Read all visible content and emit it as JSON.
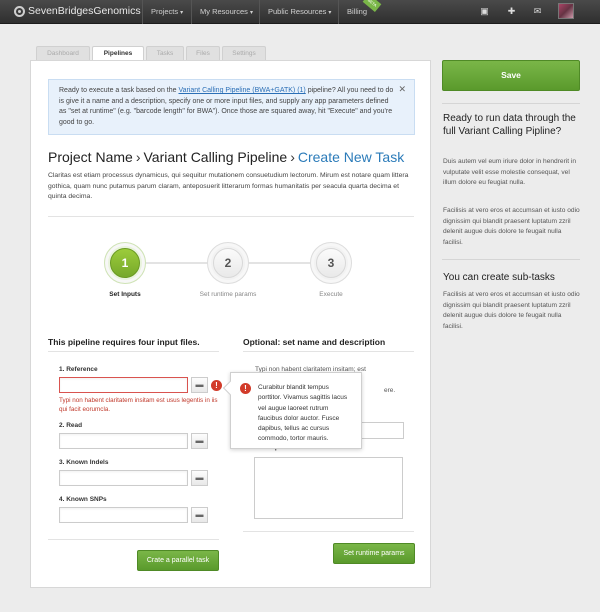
{
  "nav": {
    "logo": "SevenBridgesGenomics",
    "items": [
      {
        "label": "Projects",
        "caret": "▾"
      },
      {
        "label": "My Resources",
        "caret": "▾"
      },
      {
        "label": "Public Resources",
        "caret": "▾"
      },
      {
        "label": "Billing",
        "caret": ""
      }
    ],
    "beta_label": "BETA",
    "icons": [
      "presentation-icon",
      "add-user-icon",
      "mail-icon"
    ]
  },
  "tabs": [
    {
      "label": "Dashboard",
      "active": false
    },
    {
      "label": "Pipelines",
      "active": true
    },
    {
      "label": "Tasks",
      "active": false
    },
    {
      "label": "Files",
      "active": false
    },
    {
      "label": "Settings",
      "active": false
    }
  ],
  "alert": {
    "text_before": "Ready to execute a task based on the ",
    "link": "Variant Calling Pipeline (BWA+GATK) (1)",
    "text_after": " pipeline? All you need to do is give it a name and a description, specify one or more input files, and supply any app parameters defined as \"set at runtime\" (e.g. \"barcode length\" for BWA\"). Once those are squared away, hit \"Execute\" and you're good to go.",
    "close": "✕"
  },
  "breadcrumb": {
    "project": "Project Name",
    "separator": "›",
    "pipeline": "Variant Calling Pipeline",
    "current": "Create New Task"
  },
  "description": "Claritas est etiam processus dynamicus, qui sequitur mutationem consuetudium lectorum. Mirum est notare quam littera gothica, quam nunc putamus parum claram, anteposuerit litterarum formas humanitatis per seacula quarta decima et quinta decima.",
  "steps": [
    {
      "number": "1",
      "label": "Set Inputs",
      "active": true
    },
    {
      "number": "2",
      "label": "Set runtime params",
      "active": false
    },
    {
      "number": "3",
      "label": "Execute",
      "active": false
    }
  ],
  "inputs_section": {
    "title": "This pipeline requires four input files.",
    "fields": [
      {
        "label": "1. Reference",
        "error": true
      },
      {
        "label": "2. Read",
        "error": false
      },
      {
        "label": "3. Known Indels",
        "error": false
      },
      {
        "label": "4. Known SNPs",
        "error": false
      }
    ],
    "error_message": "Typi non habent claritatem insitam est usus legentis in iis qui facit eorumcla.",
    "parallel_button": "Crate a parallel task"
  },
  "optional_section": {
    "title": "Optional: set name and description",
    "hint_line1": "Typi non habent claritatem insitam; est",
    "hint_line2": "ere.",
    "description_label": "Description",
    "next_button": "Set runtime params"
  },
  "tooltip": {
    "text": "Curabitur blandit tempus porttitor. Vivamus sagittis lacus vel augue laoreet rutrum faucibus dolor auctor. Fusce dapibus, tellus ac cursus commodo, tortor mauris."
  },
  "sidebar": {
    "save": "Save",
    "heading1": "Ready to run data through the full Variant Calling Pipline?",
    "para1": "Duis autem vel eum iriure dolor in hendrerit in vulputate velit esse molestie consequat, vel illum dolore eu feugiat nulla.",
    "para2": "Facilisis at vero eros et accumsan et iusto odio dignissim qui blandit praesent luptatum zzril delenit augue duis dolore te feugait nulla facilisi.",
    "heading2": "You can create sub-tasks",
    "para3": "Facilisis at vero eros et accumsan et iusto odio dignissim qui blandit praesent luptatum zzril delenit augue duis dolore te feugait nulla facilisi."
  },
  "colors": {
    "accent_green": "#6aa83a",
    "link_blue": "#2b7bb9",
    "error_red": "#d23b2a"
  }
}
